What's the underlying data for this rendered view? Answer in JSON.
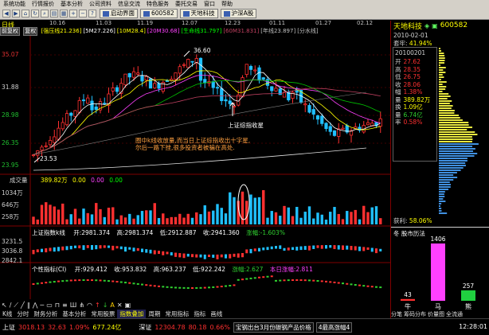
{
  "menubar": {
    "items": [
      "系统功能",
      "行情报价",
      "基本分析",
      "公司资料",
      "信息交流",
      "特色服务",
      "委托交易",
      "窗口",
      "帮助"
    ]
  },
  "toolbar": {
    "buttons": [
      "启动界面",
      "600582",
      "天地科技",
      "沪深A股"
    ]
  },
  "chart": {
    "stock_label": "日线",
    "dates": [
      "10.16",
      "11.03",
      "11.19",
      "12.07",
      "12.23",
      "01.11",
      "01.27",
      "02.12"
    ],
    "nav_buttons": [
      "前复权",
      "复权"
    ],
    "ma_items": [
      {
        "text": "[强压线21.236]",
        "color": "#ffff00"
      },
      {
        "text": "[5M27.226]",
        "color": "#ffffff"
      },
      {
        "text": "[10M28.4]",
        "color": "#ffff00"
      },
      {
        "text": "[20M30.68]",
        "color": "#ff40ff"
      },
      {
        "text": "[生命线31.797]",
        "color": "#00ff00"
      },
      {
        "text": "[60M31.831]",
        "color": "#c04060"
      },
      {
        "text": "[年线23.897]",
        "color": "#c0c0c0"
      },
      {
        "text": "[分水线]",
        "color": "#c0c0c0"
      }
    ],
    "y_labels": [
      "35.07",
      "31.88",
      "28.98",
      "26.35",
      "23.95"
    ],
    "peak_label": "36.60",
    "low_label": "23.53",
    "annot_right": "上证综指收星",
    "annot_orange": [
      "圈中k线收放量,而当日上证综指收出十字星,",
      "尔后一路下挫,很多投资者被骗在高处."
    ],
    "vol_title": "成交量",
    "vol_value": "389.82万",
    "vol_ma": [
      "0.00",
      "0.00",
      "0.00"
    ],
    "vol_ylabels": [
      "1034万",
      "646万",
      "258万"
    ],
    "index_pane": {
      "name": "上证指数k线",
      "open": "开:2981.374",
      "high": "高:2981.374",
      "low": "低:2912.887",
      "close": "收:2941.360",
      "change": "涨幅:-1.603%",
      "ylabels": [
        "3231.5",
        "3036.8",
        "2842.1"
      ]
    },
    "ind_pane": {
      "name": "个性指标(CI)",
      "open": "开:929.412",
      "close": "收:953.832",
      "high": "高:963.237",
      "low": "低:922.242",
      "change": "涨幅:2.627",
      "today": "本日涨幅:2.811"
    }
  },
  "data_tabs": [
    "K线",
    "分时",
    "财务分析",
    "基本分析",
    "常用股票",
    "指数叠加",
    "周期",
    "常用指标",
    "指标",
    "画线"
  ],
  "data_tabs_active": 5,
  "right_panel": {
    "name": "天地科技",
    "code": "600582",
    "date": "2010-02-01",
    "winner_pct_label": "套牢:",
    "winner_pct": "41.94%",
    "box_header": "20100201",
    "box_rows": [
      {
        "k": "开",
        "v": "27.62",
        "c": "r"
      },
      {
        "k": "高",
        "v": "28.35",
        "c": "r"
      },
      {
        "k": "低",
        "v": "26.75",
        "c": "r"
      },
      {
        "k": "收",
        "v": "28.06",
        "c": "r"
      },
      {
        "k": "幅",
        "v": "1.38%",
        "c": "r"
      },
      {
        "k": "量",
        "v": "389.82万",
        "c": "y"
      },
      {
        "k": "换",
        "v": "1.09亿",
        "c": "y"
      },
      {
        "k": "量",
        "v": "6.74亿",
        "c": "g"
      },
      {
        "k": "率",
        "v": "0.58%",
        "c": "r"
      }
    ],
    "profit_label": "获利:",
    "profit_value": "58.06%",
    "win_title": "冬    股市历法",
    "bars": [
      {
        "label": "牛",
        "value": 43
      },
      {
        "label": "马",
        "value": 1406
      },
      {
        "label": "熊",
        "value": 257
      }
    ],
    "tabs": [
      "分笔",
      "筹码分布",
      "价量图",
      "全流通"
    ]
  },
  "status": {
    "sh_name": "上证",
    "sh_value": "3018.13",
    "sh_change": "32.63",
    "sh_pct": "1.09%",
    "sh_amount": "677.24亿",
    "sz_name": "深证",
    "sz_value": "12304.78",
    "sz_change": "80.18",
    "sz_pct": "0.66%",
    "news": "宝钢出台3月份碳钢产品价格",
    "news2": "4最高涨幅4",
    "time": "12:28:01"
  }
}
